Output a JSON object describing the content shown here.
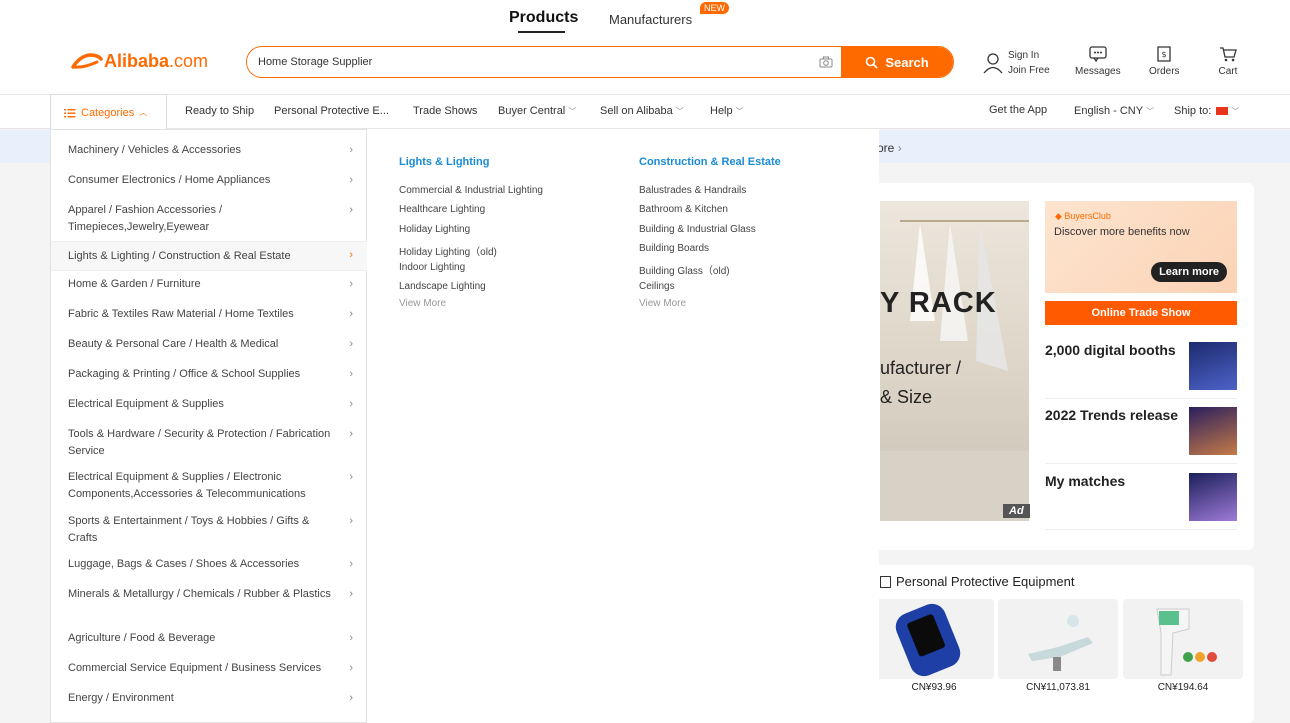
{
  "header": {
    "tabs": [
      {
        "label": "Products",
        "active": true
      },
      {
        "label": "Manufacturers",
        "active": false
      }
    ],
    "new_badge": "NEW",
    "logo": {
      "mark": "⅁",
      "name": "Alibaba",
      "suffix": ".com"
    },
    "search": {
      "value": "Home Storage Supplier",
      "button": "Search"
    },
    "signin": {
      "line1": "Sign In",
      "line2": "Join Free"
    },
    "actions": {
      "messages": "Messages",
      "orders": "Orders",
      "cart": "Cart"
    }
  },
  "nav": {
    "categories": "Categories",
    "items": [
      "Ready to Ship",
      "Personal Protective E...",
      "Trade Shows",
      "Buyer Central",
      "Sell on Alibaba",
      "Help"
    ],
    "get_app": "Get the App",
    "language": "English - CNY",
    "ship_to": "Ship to:"
  },
  "categories": [
    {
      "label": "Machinery / Vehicles & Accessories"
    },
    {
      "label": "Consumer Electronics / Home Appliances"
    },
    {
      "label": "Apparel / Fashion Accessories / Timepieces,Jewelry,Eyewear"
    },
    {
      "label": "Lights & Lighting / Construction & Real Estate"
    },
    {
      "label": "Home & Garden / Furniture"
    },
    {
      "label": "Fabric & Textiles Raw Material / Home Textiles"
    },
    {
      "label": "Beauty & Personal Care / Health & Medical"
    },
    {
      "label": "Packaging & Printing / Office & School Supplies"
    },
    {
      "label": "Electrical Equipment & Supplies"
    },
    {
      "label": "Tools & Hardware / Security & Protection / Fabrication Service"
    },
    {
      "label": "Electrical Equipment & Supplies / Electronic Components,Accessories & Telecommunications"
    },
    {
      "label": "Sports & Entertainment / Toys & Hobbies / Gifts & Crafts"
    },
    {
      "label": "Luggage, Bags & Cases / Shoes & Accessories"
    },
    {
      "label": "Minerals & Metallurgy / Chemicals / Rubber & Plastics"
    },
    {
      "label": "Agriculture / Food & Beverage"
    },
    {
      "label": "Commercial Service Equipment / Business Services"
    },
    {
      "label": "Energy / Environment"
    }
  ],
  "subcategories": [
    {
      "heading": "Lights & Lighting",
      "links": [
        "Commercial & Industrial Lighting",
        "Healthcare Lighting",
        "Holiday Lighting",
        "Holiday Lighting（old)",
        "Indoor Lighting",
        "Landscape Lighting"
      ],
      "more": "View More"
    },
    {
      "heading": "Construction & Real Estate",
      "links": [
        "Balustrades & Handrails",
        "Bathroom & Kitchen",
        "Building & Industrial Glass",
        "Building Boards",
        "Building Glass（old)",
        "Ceilings"
      ],
      "more": "View More"
    }
  ],
  "background": {
    "more_link": "ore",
    "banner_line1": "Y RACK",
    "banner_line2": "ufacturer /",
    "banner_line3": "& Size",
    "ad": "Ad",
    "buyers_club": "BuyersClub",
    "buyers_desc": "Discover more benefits now",
    "learn_more": "Learn more",
    "trade_show": "Online Trade Show",
    "promos": [
      "2,000 digital booths",
      "2022 Trends release",
      "My matches"
    ],
    "ppe_title": "Personal Protective Equipment",
    "prices": [
      "CN¥93.96",
      "CN¥11,073.81",
      "CN¥194.64"
    ]
  },
  "colors": {
    "brand": "#ff6a00",
    "link_blue": "#1a8bd6"
  }
}
